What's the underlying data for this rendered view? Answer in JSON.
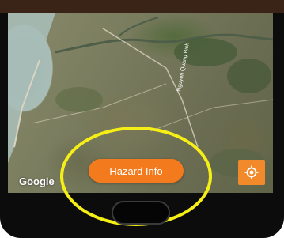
{
  "map": {
    "attribution": "Google",
    "road_label": "Nguyen Quang Bich"
  },
  "buttons": {
    "hazard_info_label": "Hazard Info"
  },
  "icons": {
    "location": "my-location-icon"
  },
  "colors": {
    "hazard_button": "#f47a1e",
    "location_button": "#f28a2b",
    "highlight": "#f6ef17"
  }
}
